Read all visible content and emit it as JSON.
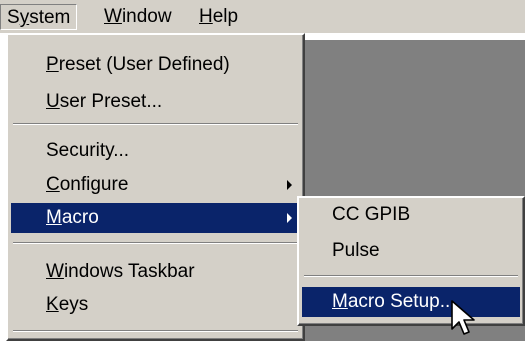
{
  "menubar": {
    "items": [
      {
        "label": "System",
        "accel": "y",
        "state": "open"
      },
      {
        "label": "Window",
        "accel": "W"
      },
      {
        "label": "Help",
        "accel": "H"
      }
    ]
  },
  "system_menu": {
    "items": [
      {
        "pre": "",
        "accel": "P",
        "post": "reset (User Defined)"
      },
      {
        "pre": "",
        "accel": "U",
        "post": "ser Preset..."
      },
      {
        "pre": "Security...",
        "accel": "",
        "post": ""
      },
      {
        "pre": "",
        "accel": "C",
        "post": "onfigure",
        "submenu": true
      },
      {
        "pre": "",
        "accel": "M",
        "post": "acro",
        "submenu": true,
        "highlighted": true
      },
      {
        "pre": "",
        "accel": "W",
        "post": "indows Taskbar"
      },
      {
        "pre": "",
        "accel": "K",
        "post": "eys"
      }
    ]
  },
  "macro_submenu": {
    "items": [
      {
        "pre": "CC GPIB",
        "accel": "",
        "post": ""
      },
      {
        "pre": "Pulse",
        "accel": "",
        "post": ""
      },
      {
        "pre": "",
        "accel": "M",
        "post": "acro Setup...",
        "highlighted": true
      }
    ]
  },
  "colors": {
    "menu_face": "#d4d0c8",
    "highlight": "#0a246a",
    "workspace": "#808080"
  },
  "cursor": {
    "icon": "arrow-pointer-icon"
  }
}
